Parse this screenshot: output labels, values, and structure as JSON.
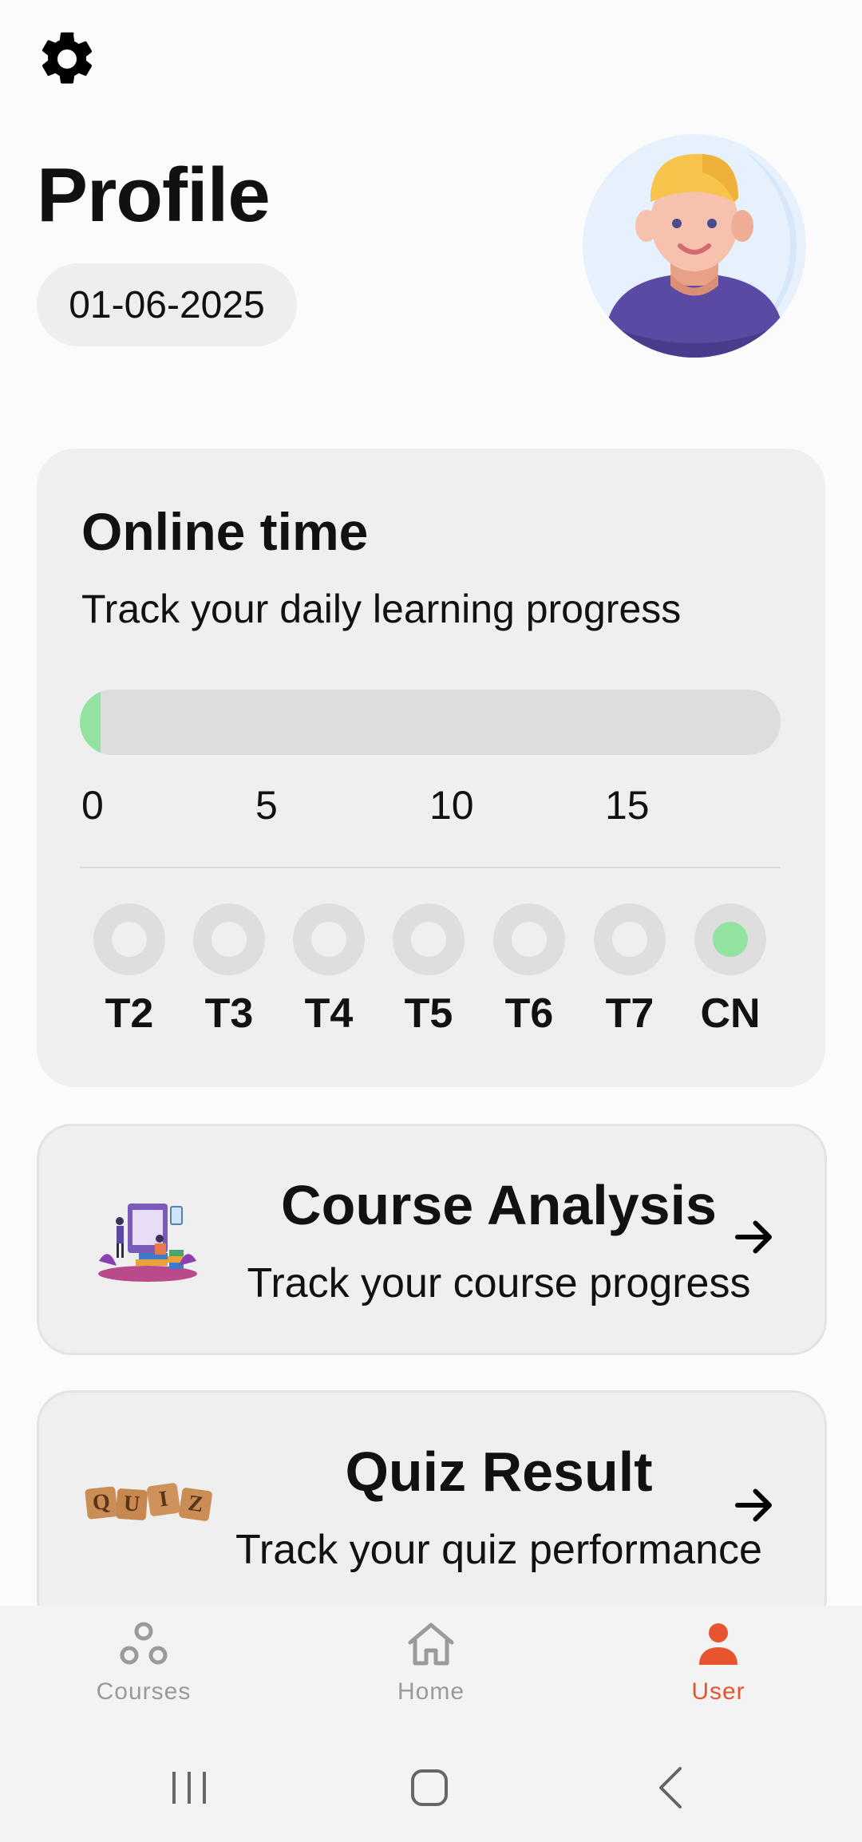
{
  "header": {
    "title": "Profile",
    "date": "01-06-2025"
  },
  "online_time": {
    "title": "Online time",
    "subtitle": "Track your daily learning progress",
    "progress_fraction": 0.03,
    "ticks": [
      "0",
      "5",
      "10",
      "15"
    ],
    "days": [
      {
        "label": "T2",
        "active": false
      },
      {
        "label": "T3",
        "active": false
      },
      {
        "label": "T4",
        "active": false
      },
      {
        "label": "T5",
        "active": false
      },
      {
        "label": "T6",
        "active": false
      },
      {
        "label": "T7",
        "active": false
      },
      {
        "label": "CN",
        "active": true
      }
    ]
  },
  "cards": {
    "course_analysis": {
      "title": "Course Analysis",
      "subtitle": "Track your course progress"
    },
    "quiz_result": {
      "title": "Quiz Result",
      "subtitle": "Track your quiz performance",
      "badge_letters": [
        "Q",
        "U",
        "I",
        "Z"
      ]
    }
  },
  "bottom_nav": [
    {
      "label": "Courses",
      "icon": "courses-icon",
      "active": false
    },
    {
      "label": "Home",
      "icon": "home-icon",
      "active": false
    },
    {
      "label": "User",
      "icon": "user-icon",
      "active": true
    }
  ],
  "colors": {
    "accent": "#e8542f",
    "progress": "#93e3a0",
    "card": "#efefef"
  }
}
